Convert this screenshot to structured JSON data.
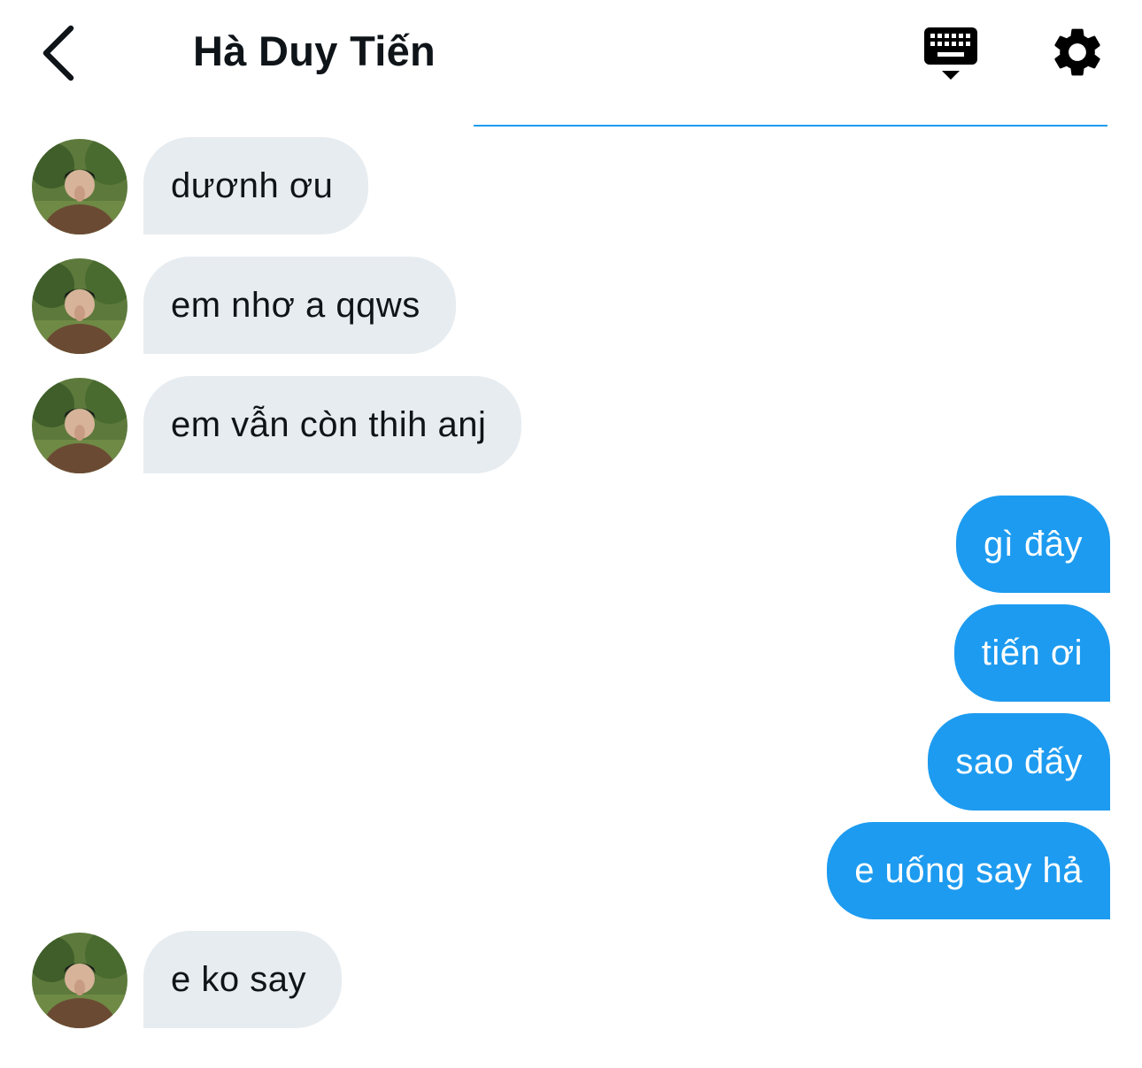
{
  "header": {
    "title": "Hà Duy Tiến",
    "back_icon": "chevron-left-icon",
    "keyboard_icon": "keyboard-hide-icon",
    "settings_icon": "gear-icon"
  },
  "colors": {
    "accent": "#1d9bf0",
    "incoming_bubble": "#e7ecf0",
    "text": "#0f1419"
  },
  "messages": [
    {
      "side": "in",
      "text": "dươnh ơu"
    },
    {
      "side": "in",
      "text": "em nhơ a qqws"
    },
    {
      "side": "in",
      "text": "em vẫn còn thih anj"
    },
    {
      "side": "out",
      "text": "gì đây"
    },
    {
      "side": "out",
      "text": "tiến ơi"
    },
    {
      "side": "out",
      "text": "sao đấy"
    },
    {
      "side": "out",
      "text": "e uống say hả"
    },
    {
      "side": "in",
      "text": "e ko say"
    }
  ]
}
